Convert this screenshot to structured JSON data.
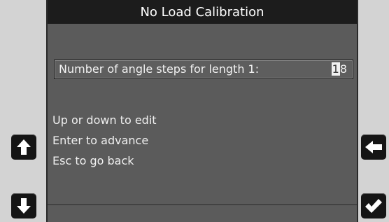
{
  "title": "No Load Calibration",
  "field": {
    "label": "Number of angle steps for length 1:",
    "value_cursor_digit": "1",
    "value_rest": "8"
  },
  "instructions": [
    "Up or down to edit",
    "Enter to advance",
    "Esc to go back"
  ],
  "icons": {
    "up": "arrow-up-icon",
    "down": "arrow-down-icon",
    "back": "arrow-left-icon",
    "confirm": "checkmark-icon"
  },
  "colors": {
    "screen_bg": "#5b5b5b",
    "title_bg": "#1c1c1c",
    "button_bg": "#151515",
    "text": "#f0f0f0"
  }
}
